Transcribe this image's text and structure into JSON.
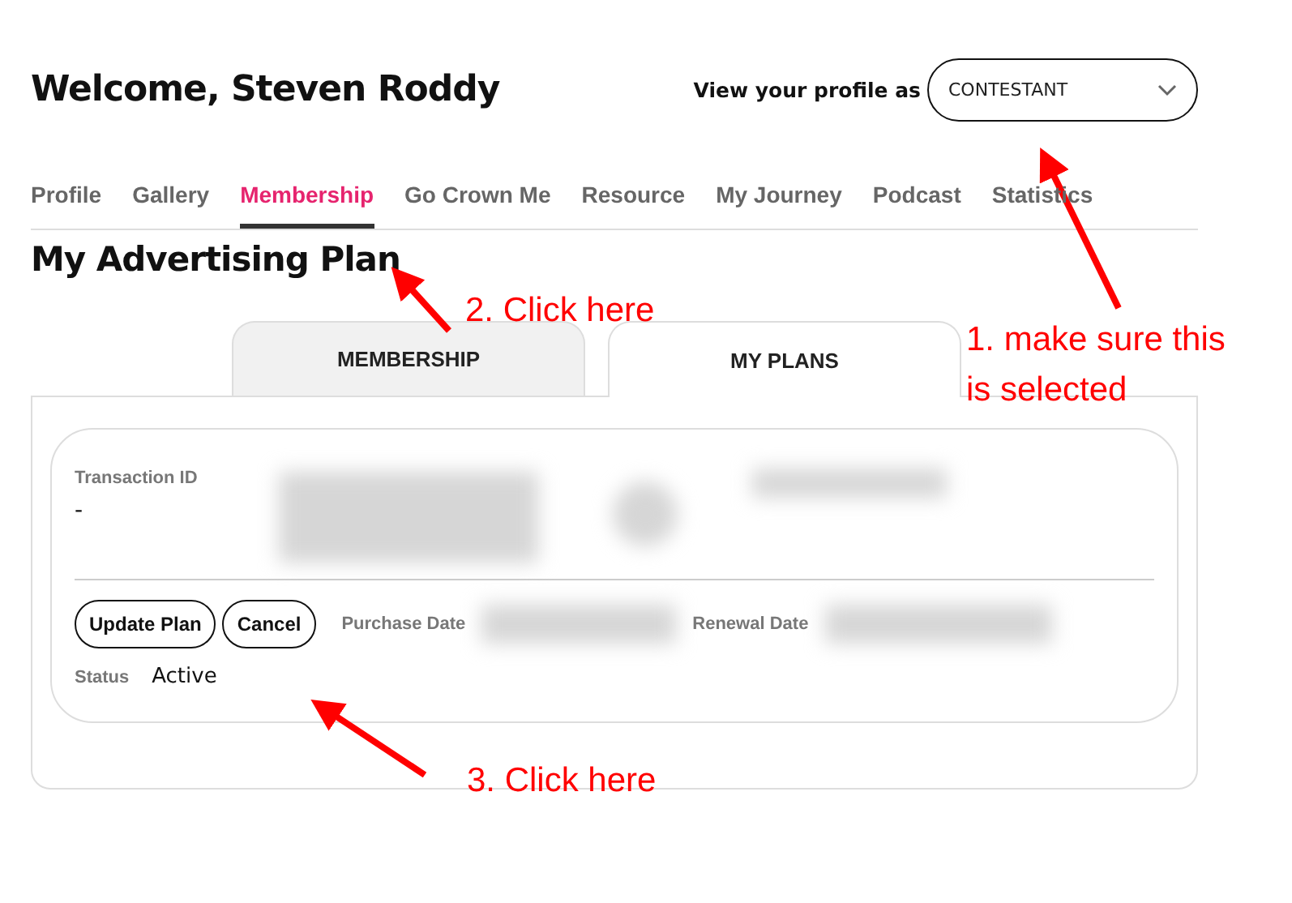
{
  "header": {
    "title": "Welcome, Steven Roddy",
    "view_as_label": "View your profile as",
    "view_as_value": "CONTESTANT"
  },
  "nav_tabs": [
    {
      "label": "Profile",
      "selected": false
    },
    {
      "label": "Gallery",
      "selected": false
    },
    {
      "label": "Membership",
      "selected": true
    },
    {
      "label": "Go Crown Me",
      "selected": false
    },
    {
      "label": "Resource",
      "selected": false
    },
    {
      "label": "My Journey",
      "selected": false
    },
    {
      "label": "Podcast",
      "selected": false
    },
    {
      "label": "Statistics",
      "selected": false
    }
  ],
  "section_title": "My Advertising Plan",
  "plan_tabs": [
    {
      "label": "MEMBERSHIP",
      "selected": false
    },
    {
      "label": "MY PLANS",
      "selected": true
    }
  ],
  "plan_card": {
    "transaction_label": "Transaction ID",
    "transaction_value": "-",
    "buttons": [
      "Update Plan",
      "Cancel"
    ],
    "purchase_date_label": "Purchase Date",
    "renewal_date_label": "Renewal Date",
    "status_label": "Status",
    "status_value": "Active"
  },
  "annotations": [
    {
      "text": "1. make sure this is selected"
    },
    {
      "text": "2. Click here"
    },
    {
      "text": "3. Click here"
    }
  ]
}
